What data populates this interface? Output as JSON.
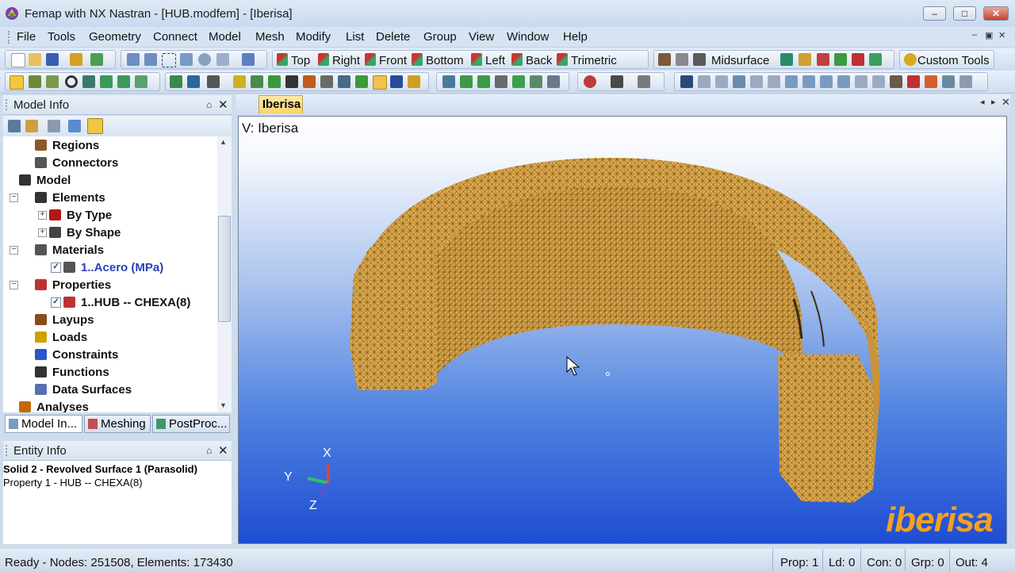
{
  "window": {
    "title": "Femap with NX Nastran - [HUB.modfem] - [Iberisa]",
    "minimize": "–",
    "maximize": "□",
    "close": "✕"
  },
  "menu": [
    "File",
    "Tools",
    "Geometry",
    "Connect",
    "Model",
    "Mesh",
    "Modify",
    "List",
    "Delete",
    "Group",
    "View",
    "Window",
    "Help"
  ],
  "mdi_controls": {
    "minimize": "–",
    "restore": "▣",
    "close": "✕"
  },
  "toolbar1": {
    "views": [
      "Top",
      "Right",
      "Front",
      "Bottom",
      "Left",
      "Back",
      "Trimetric"
    ],
    "midsurface": "Midsurface",
    "custom_tools": "Custom Tools"
  },
  "model_info": {
    "title": "Model Info",
    "pin": "⌂",
    "close": "✕",
    "tree": [
      {
        "label": "Regions",
        "indent": 2,
        "icon": "regions-icon",
        "color": "#8b5a2b"
      },
      {
        "label": "Connectors",
        "indent": 2,
        "icon": "connectors-icon",
        "color": "#555"
      },
      {
        "label": "Model",
        "indent": 1,
        "icon": "model-icon",
        "color": "#333",
        "expander": "−"
      },
      {
        "label": "Elements",
        "indent": 2,
        "icon": "elements-icon",
        "color": "#333",
        "expander": "−"
      },
      {
        "label": "By Type",
        "indent": 3,
        "icon": "by-type-icon",
        "color": "#b01818",
        "expander": "+"
      },
      {
        "label": "By Shape",
        "indent": 3,
        "icon": "by-shape-icon",
        "color": "#444",
        "expander": "+"
      },
      {
        "label": "Materials",
        "indent": 2,
        "icon": "materials-icon",
        "color": "#555",
        "expander": "−"
      },
      {
        "label": "1..Acero (MPa)",
        "indent": 3,
        "icon": "material-item-icon",
        "color": "#555",
        "checked": true,
        "blue": true
      },
      {
        "label": "Properties",
        "indent": 2,
        "icon": "properties-icon",
        "color": "#b33",
        "expander": "−"
      },
      {
        "label": "1..HUB -- CHEXA(8)",
        "indent": 3,
        "icon": "property-item-icon",
        "color": "#b33",
        "checked": true
      },
      {
        "label": "Layups",
        "indent": 2,
        "icon": "layups-icon",
        "color": "#8b4a1b"
      },
      {
        "label": "Loads",
        "indent": 2,
        "icon": "loads-icon",
        "color": "#d0a000"
      },
      {
        "label": "Constraints",
        "indent": 2,
        "icon": "constraints-icon",
        "color": "#2b55c8"
      },
      {
        "label": "Functions",
        "indent": 2,
        "icon": "functions-icon",
        "color": "#333"
      },
      {
        "label": "Data Surfaces",
        "indent": 2,
        "icon": "data-surfaces-icon",
        "color": "#5a6fb0"
      },
      {
        "label": "Analyses",
        "indent": 1,
        "icon": "analyses-icon",
        "color": "#c06a10"
      }
    ],
    "tabs": [
      "Model In...",
      "Meshing",
      "PostProc..."
    ]
  },
  "entity_info": {
    "title": "Entity Info",
    "pin": "⌂",
    "close": "✕",
    "line1": "Solid 2 - Revolved Surface 1 (Parasolid)",
    "line2": "Property 1 - HUB -- CHEXA(8)"
  },
  "view": {
    "tab": "Iberisa",
    "label": "V: Iberisa",
    "triad": {
      "x": "X",
      "y": "Y",
      "z": "Z"
    },
    "logo": "iberisa",
    "nav": [
      "◂",
      "▸",
      "✕"
    ],
    "mesh_color": "#e3ad4e"
  },
  "status": {
    "ready": "Ready - Nodes: 251508,  Elements: 173430",
    "prop": "Prop: 1",
    "ld": "Ld: 0",
    "con": "Con: 0",
    "grp": "Grp: 0",
    "out": "Out: 4"
  }
}
